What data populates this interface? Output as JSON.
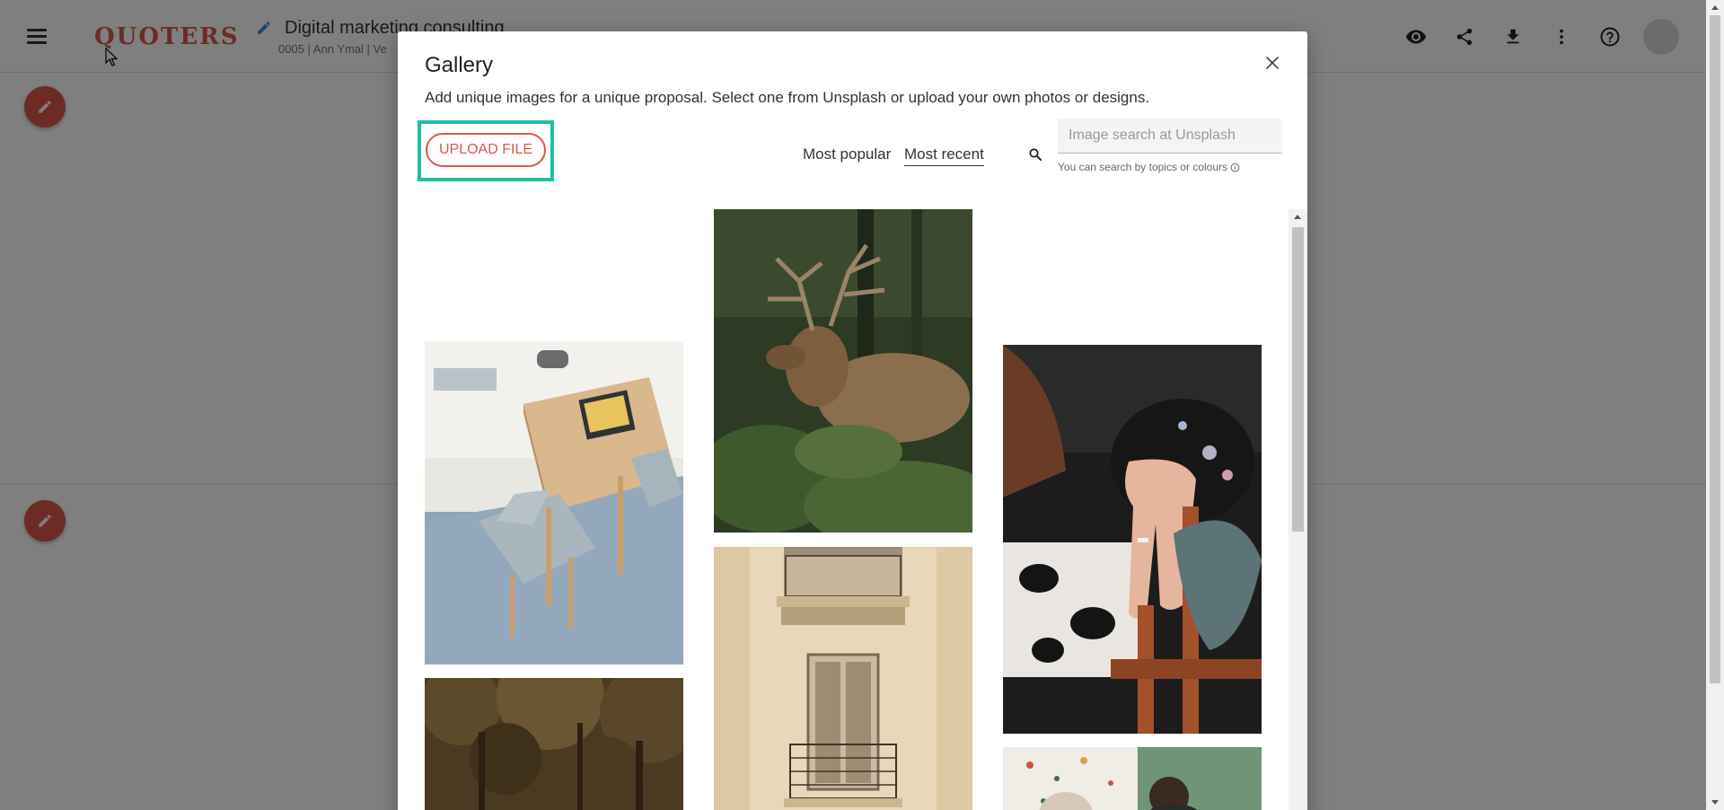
{
  "app": {
    "logo": "QUOTERS",
    "doc_title": "Digital marketing consulting",
    "doc_subtitle": "0005 | Ann Ymal | Ve",
    "brand_color": "#d8584a",
    "top_actions": [
      "eye-icon",
      "share-icon",
      "download-icon",
      "more-vert-icon",
      "help-icon"
    ]
  },
  "modal": {
    "title": "Gallery",
    "description": "Add unique images for a unique proposal. Select one from Unsplash or upload your own photos or designs.",
    "upload_label": "UPLOAD FILE",
    "highlight_color": "#1dbfa6",
    "sort": {
      "popular_label": "Most popular",
      "recent_label": "Most recent",
      "selected": "Most recent"
    },
    "search": {
      "placeholder": "Image search at Unsplash",
      "value": "",
      "hint": "You can search by topics or colours"
    }
  },
  "gallery": {
    "photos": [
      "table-chair-laptop-photo",
      "deer-elk-photo",
      "woman-hand-ring-photo",
      "forest-trees-photo",
      "building-balcony-photo",
      "green-wall-people-photo"
    ]
  }
}
